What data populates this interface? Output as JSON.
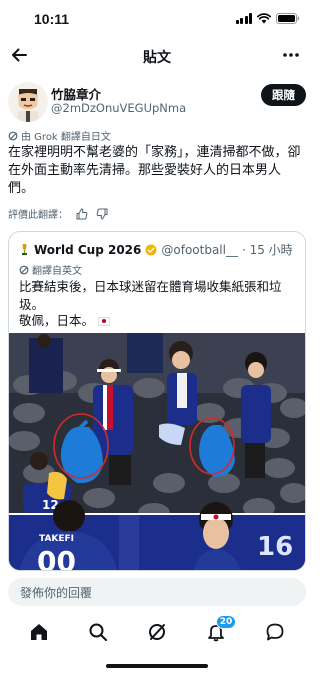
{
  "status_bar": {
    "time": "10:11"
  },
  "header": {
    "title": "貼文",
    "back_icon": "arrow-left-icon",
    "more_icon": "more-horizontal-icon"
  },
  "post": {
    "author_name": "竹脇章介",
    "author_handle": "@2mDzOnuVEGUpNma",
    "follow_label": "跟隨",
    "translation_note": "由 Grok 翻譯自日文",
    "text": "在家裡明明不幫老婆的「家務」，連清掃都不做，卻在外面主動率先清掃。那些愛裝好人的日本男人們。",
    "rate_label": "評價此翻譯："
  },
  "quote": {
    "author_name": "World Cup 2026",
    "author_handle": "@ofootball__",
    "time": "· 15 小時",
    "translation_note": "翻譯自英文",
    "text1": "比賽結束後，日本球迷留在體育場收集紙張和垃圾。",
    "text2": "敬佩，日本。",
    "jersey_name": "TAKEFI",
    "jersey_number": "16"
  },
  "reply": {
    "placeholder": "發佈你的回覆"
  },
  "tabs": {
    "notification_count": "20"
  },
  "colors": {
    "accent": "#1d9bf0",
    "text": "#0f1419",
    "secondary": "#536471"
  }
}
